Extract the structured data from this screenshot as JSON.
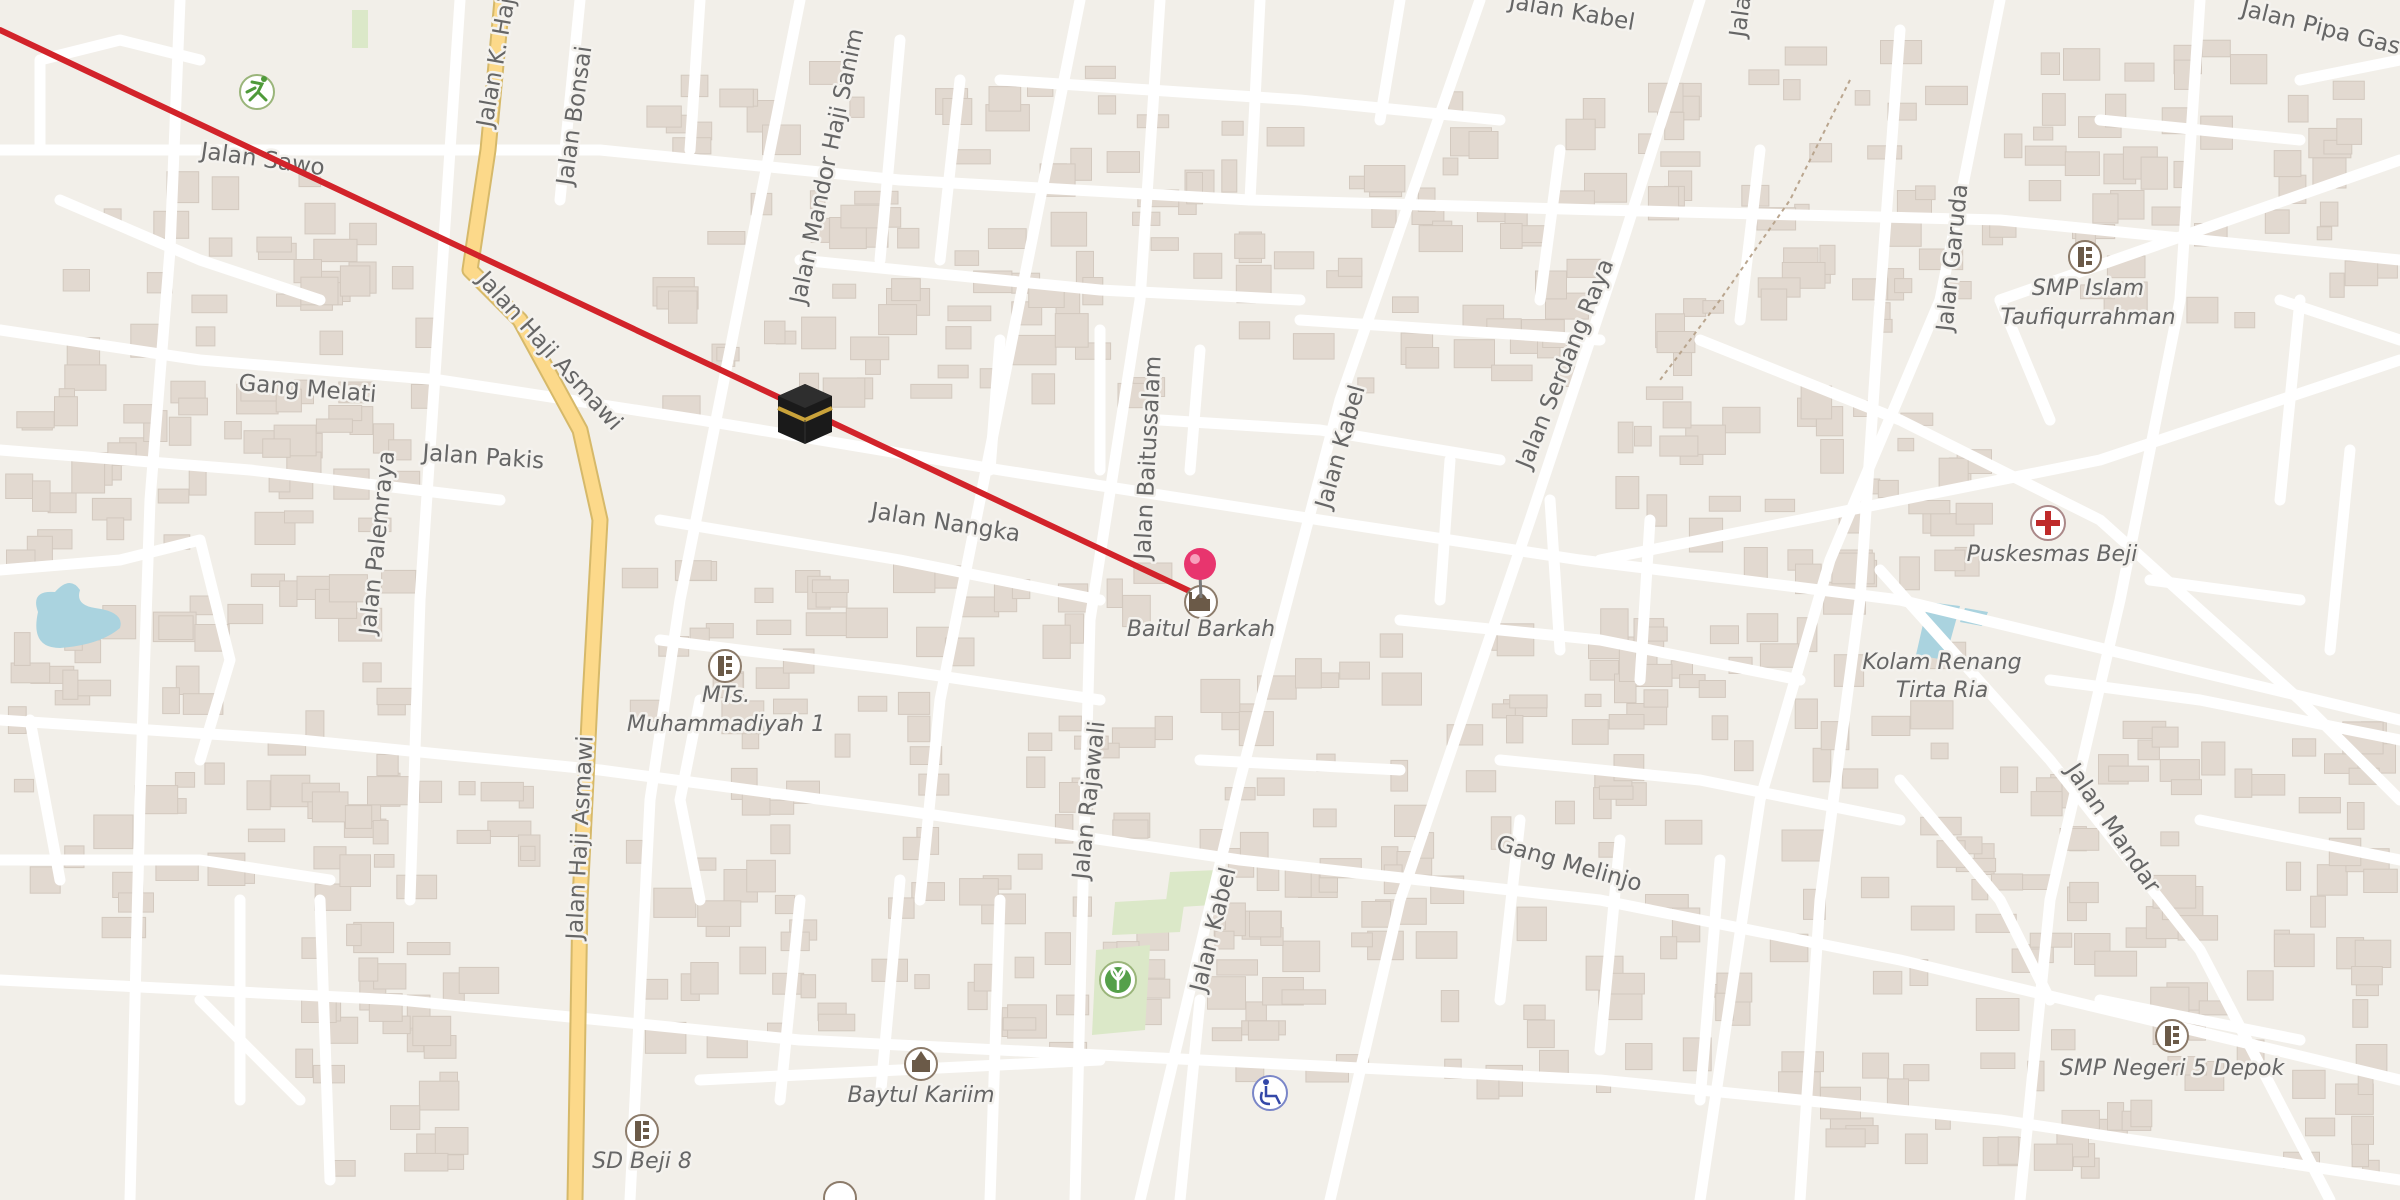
{
  "map": {
    "streets": [
      "Jalan Sawo",
      "Jalan K. Haji",
      "Jalan Bonsai",
      "Jalan Mandor Haji Sanim",
      "Jalan Haji Asmawi",
      "Gang Melati",
      "Jalan Pakis",
      "Jalan Palemraya",
      "Jalan Nangka",
      "Jalan Baitussalam",
      "Jalan Kabel",
      "Jalan Serdang Raya",
      "Jalan Garuda",
      "Jalan Rajawali",
      "Jalan Kabel",
      "Gang Melinjo",
      "Jalan Mandar",
      "Jalan Haji Asmawi",
      "Jalan Kabel",
      "Jalan Pipa Gas",
      "Jala"
    ],
    "pois": [
      {
        "label": "Baitul Barkah",
        "icon": "mosque-icon"
      },
      {
        "label": "SMP Islam",
        "label2": "Taufiqurrahman",
        "icon": "school-icon"
      },
      {
        "label": "Puskesmas Beji",
        "icon": "clinic-icon"
      },
      {
        "label": "Kolam Renang",
        "label2": "Tirta Ria"
      },
      {
        "label": "MTs.",
        "label2": "Muhammadiyah 1",
        "icon": "school-icon"
      },
      {
        "label": "Baytul Kariim",
        "icon": "place-of-worship-icon"
      },
      {
        "label": "SD Beji 8",
        "icon": "school-icon"
      },
      {
        "label": "SMP Negeri 5 Depok",
        "icon": "school-icon"
      }
    ],
    "colors": {
      "background": "#f2efe9",
      "road": "#ffffff",
      "primary_road": "#fcd98a",
      "building": "#e0d8d0",
      "water": "#aad3df",
      "park": "#d5e8c0",
      "qibla_line": "#d2232a",
      "pin": "#e8356e"
    },
    "markers": {
      "kaaba": "kaaba-icon",
      "location": "location-pin-icon"
    }
  }
}
